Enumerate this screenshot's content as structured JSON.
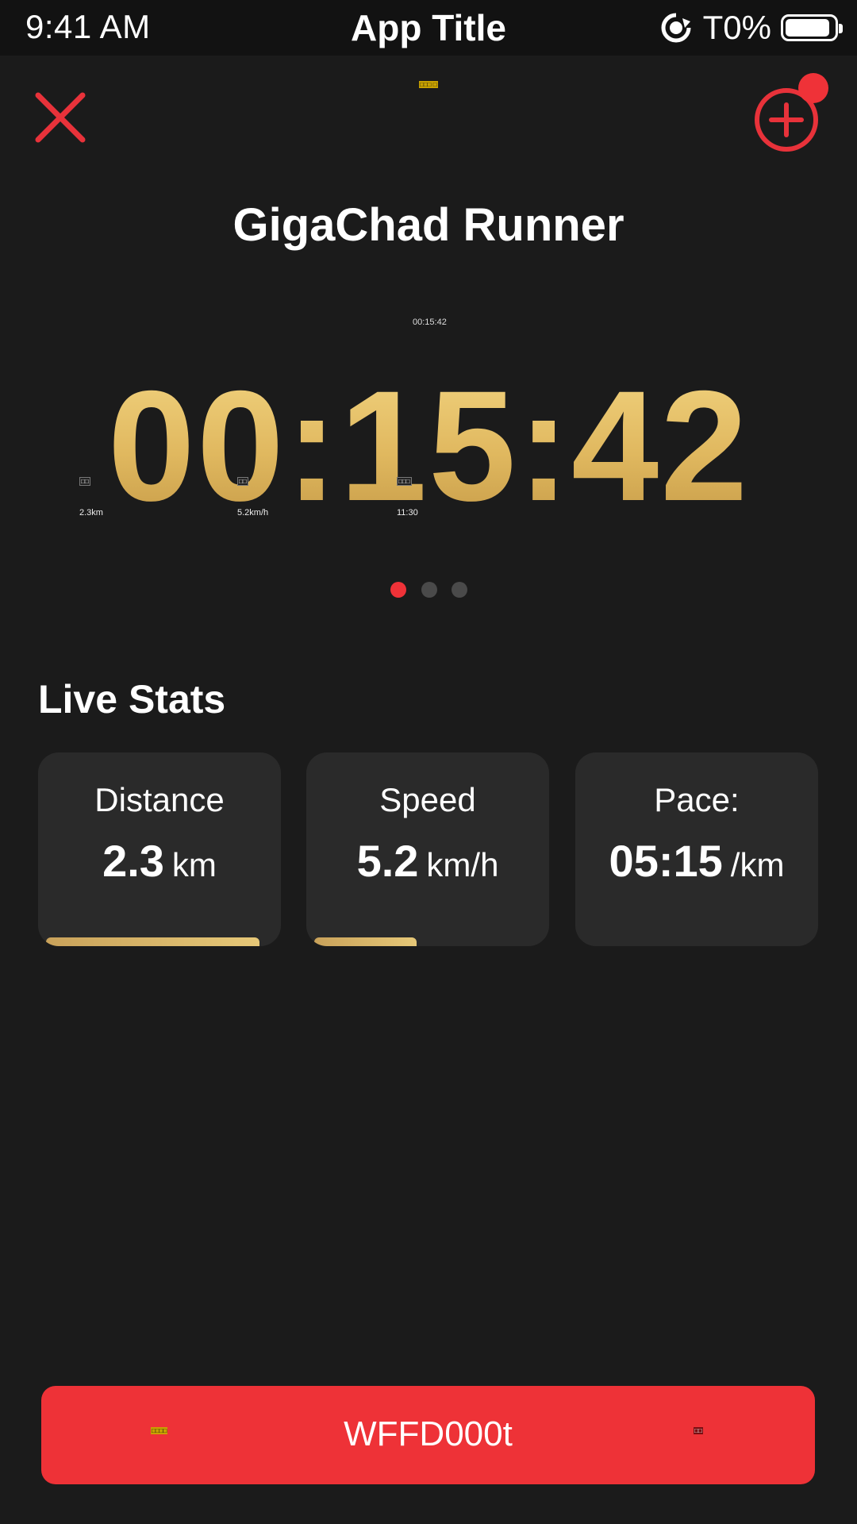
{
  "status_bar": {
    "time": "9:41 AM",
    "title": "App Title",
    "percent": "T0%",
    "battery_level": 0.92
  },
  "header": {
    "close_icon": "close-icon",
    "add_icon": "add-circle-icon",
    "tiny_glyph": "□□□ □",
    "colors": {
      "accent": "#ef3238",
      "gold": "#e2bd63"
    }
  },
  "app_name": "GigaChad Runner",
  "timer": {
    "small": "00:15:42",
    "main": "00:15:42"
  },
  "mini_stats": [
    {
      "icon": "□□",
      "value": "2.3km"
    },
    {
      "icon": "□□",
      "value": "5.2km/h"
    },
    {
      "icon": "□□□",
      "value": "11:30"
    }
  ],
  "pager": {
    "pages": 3,
    "active": 0
  },
  "live_stats": {
    "title": "Live Stats",
    "cards": [
      {
        "label": "Distance",
        "value": "2.3",
        "unit": "km",
        "progress": 0.94
      },
      {
        "label": "Speed",
        "value": "5.2",
        "unit": "km/h",
        "progress": 0.45
      },
      {
        "label": "Pace:",
        "value": "05:15",
        "unit": "/km",
        "progress": 0
      }
    ]
  },
  "primary_button": {
    "label": "WFFD000t",
    "icon_left": "□□□□",
    "icon_right": "□□"
  }
}
